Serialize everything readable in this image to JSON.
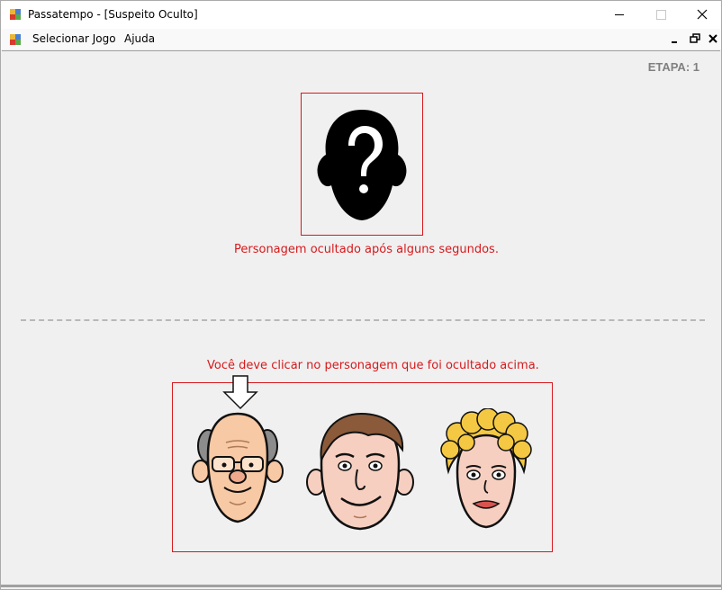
{
  "window": {
    "title": "Passatempo - [Suspeito Oculto]"
  },
  "menu": {
    "items": [
      {
        "label": "Selecionar Jogo"
      },
      {
        "label": "Ajuda"
      }
    ]
  },
  "game": {
    "stage_label": "ETAPA: 1",
    "hidden_caption": "Personagem ocultado após alguns segundos.",
    "instruction": "Você deve clicar no personagem que foi ocultado acima.",
    "hidden_icon": "question-head-icon",
    "characters": [
      {
        "name": "old-man-with-glasses"
      },
      {
        "name": "man-brown-hair"
      },
      {
        "name": "woman-blonde-curly-hair"
      }
    ],
    "selection_arrow_icon": "down-arrow-icon"
  },
  "colors": {
    "accent_red": "#d7191c",
    "stage_gray": "#808080",
    "background": "#f0f0f0"
  }
}
